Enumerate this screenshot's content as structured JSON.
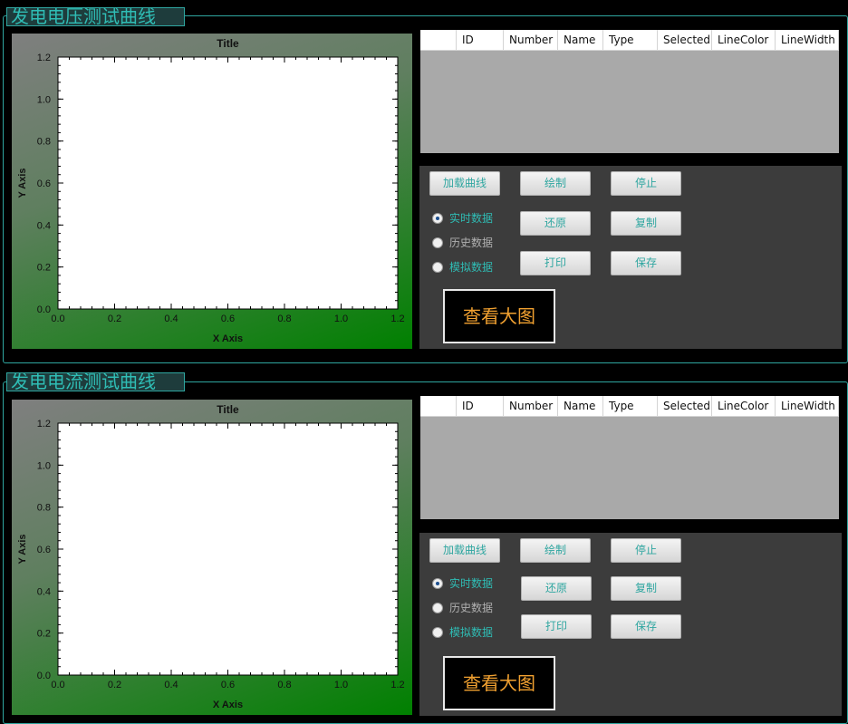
{
  "colors": {
    "accent": "#2fa6a0",
    "plot_green": "#008000",
    "big_button_text": "#f0a030"
  },
  "columns": [
    "",
    "ID",
    "Number",
    "Name",
    "Type",
    "Selected",
    "LineColor",
    "LineWidth"
  ],
  "panels": [
    {
      "title": "发电电压测试曲线",
      "buttons": {
        "load": "加载曲线",
        "draw": "绘制",
        "stop": "停止",
        "restore": "还原",
        "copy": "复制",
        "print": "打印",
        "save": "保存"
      },
      "radios": [
        {
          "label": "实时数据",
          "checked": true
        },
        {
          "label": "历史数据",
          "checked": false
        },
        {
          "label": "模拟数据",
          "checked": false
        }
      ],
      "big_button": "查看大图",
      "chart_data": {
        "type": "line",
        "title": "Title",
        "xlabel": "X Axis",
        "ylabel": "Y Axis",
        "xlim": [
          0,
          1.2
        ],
        "ylim": [
          0,
          1.2
        ],
        "xticks": [
          "0.0",
          "0.2",
          "0.4",
          "0.6",
          "0.8",
          "1.0",
          "1.2"
        ],
        "yticks": [
          "0.0",
          "0.2",
          "0.4",
          "0.6",
          "0.8",
          "1.0",
          "1.2"
        ],
        "series": []
      }
    },
    {
      "title": "发电电流测试曲线",
      "buttons": {
        "load": "加载曲线",
        "draw": "绘制",
        "stop": "停止",
        "restore": "还原",
        "copy": "复制",
        "print": "打印",
        "save": "保存"
      },
      "radios": [
        {
          "label": "实时数据",
          "checked": true
        },
        {
          "label": "历史数据",
          "checked": false
        },
        {
          "label": "模拟数据",
          "checked": false
        }
      ],
      "big_button": "查看大图",
      "chart_data": {
        "type": "line",
        "title": "Title",
        "xlabel": "X Axis",
        "ylabel": "Y Axis",
        "xlim": [
          0,
          1.2
        ],
        "ylim": [
          0,
          1.2
        ],
        "xticks": [
          "0.0",
          "0.2",
          "0.4",
          "0.6",
          "0.8",
          "1.0",
          "1.2"
        ],
        "yticks": [
          "0.0",
          "0.2",
          "0.4",
          "0.6",
          "0.8",
          "1.0",
          "1.2"
        ],
        "series": []
      }
    }
  ]
}
